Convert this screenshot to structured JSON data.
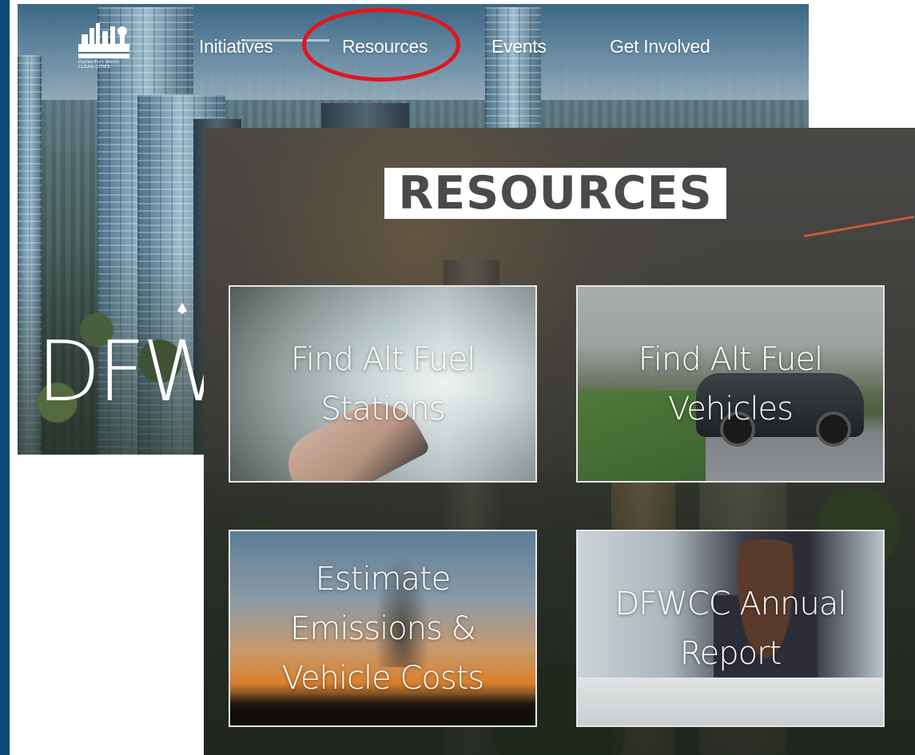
{
  "home": {
    "logo": {
      "caption_line1": "Dallas-Fort Worth",
      "caption_line2": "CLEAN CITIES"
    },
    "nav": [
      {
        "label": "Initiatives"
      },
      {
        "label": "Resources"
      },
      {
        "label": "Events"
      },
      {
        "label": "Get Involved"
      }
    ],
    "hero_title": "DFW",
    "highlight_color": "#e4141b"
  },
  "resources": {
    "title": "RESOURCES",
    "tiles": [
      {
        "label": "Find Alt Fuel Stations"
      },
      {
        "label": "Find Alt Fuel Vehicles"
      },
      {
        "label": "Estimate Emissions & Vehicle Costs"
      },
      {
        "label": "DFWCC Annual Report"
      }
    ]
  },
  "colors": {
    "brand_blue": "#0f4a78",
    "tile_border": "#e6e6e6",
    "title_text": "#4a4a4a"
  }
}
